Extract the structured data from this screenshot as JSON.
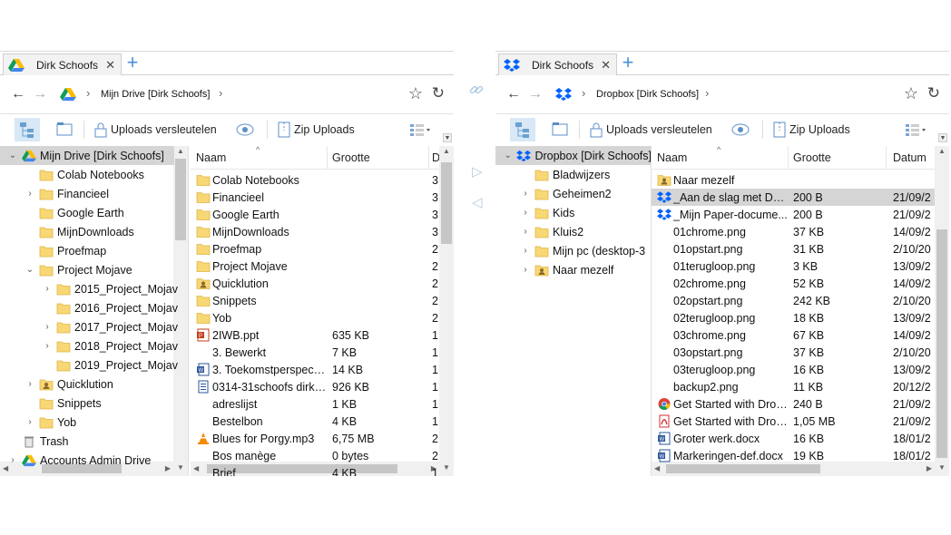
{
  "colors": {
    "accent": "#4a90d9",
    "folder": "#f8d775",
    "folder_edge": "#e0b545",
    "selection": "#d5d5d5"
  },
  "left": {
    "tab": {
      "title": "Dirk Schoofs",
      "close": "✕",
      "icon": "google-drive-icon"
    },
    "new_tab": "+",
    "nav": {
      "back": "←",
      "forward": "→",
      "sep": "›",
      "crumb": "Mijn Drive [Dirk Schoofs]",
      "star": "☆",
      "refresh": "↻"
    },
    "toolbar": {
      "encrypt": "Uploads versleutelen",
      "zip": "Zip Uploads"
    },
    "tree": [
      {
        "label": "Mijn Drive [Dirk Schoofs]",
        "arrow": "⌄",
        "level": 0,
        "icon": "drive",
        "selected": true
      },
      {
        "label": "Colab Notebooks",
        "arrow": "",
        "level": 1,
        "icon": "folder"
      },
      {
        "label": "Financieel",
        "arrow": "›",
        "level": 1,
        "icon": "folder"
      },
      {
        "label": "Google Earth",
        "arrow": "",
        "level": 1,
        "icon": "folder"
      },
      {
        "label": "MijnDownloads",
        "arrow": "",
        "level": 1,
        "icon": "folder"
      },
      {
        "label": "Proefmap",
        "arrow": "",
        "level": 1,
        "icon": "folder"
      },
      {
        "label": "Project Mojave",
        "arrow": "⌄",
        "level": 1,
        "icon": "folder"
      },
      {
        "label": "2015_Project_Mojav",
        "arrow": "›",
        "level": 2,
        "icon": "folder"
      },
      {
        "label": "2016_Project_Mojav",
        "arrow": "",
        "level": 2,
        "icon": "folder"
      },
      {
        "label": "2017_Project_Mojav",
        "arrow": "›",
        "level": 2,
        "icon": "folder"
      },
      {
        "label": "2018_Project_Mojav",
        "arrow": "›",
        "level": 2,
        "icon": "folder"
      },
      {
        "label": "2019_Project_Mojav",
        "arrow": "",
        "level": 2,
        "icon": "folder"
      },
      {
        "label": "Quicklution",
        "arrow": "›",
        "level": 1,
        "icon": "shared"
      },
      {
        "label": "Snippets",
        "arrow": "",
        "level": 1,
        "icon": "folder"
      },
      {
        "label": "Yob",
        "arrow": "›",
        "level": 1,
        "icon": "folder"
      },
      {
        "label": "Trash",
        "arrow": "",
        "level": 0,
        "icon": "trash"
      },
      {
        "label": "Accounts Admin Drive",
        "arrow": "›",
        "level": 0,
        "icon": "drive"
      }
    ],
    "columns": {
      "name": "Naam",
      "size": "Grootte",
      "date": "D"
    },
    "files": [
      {
        "name": "Colab Notebooks",
        "size": "",
        "date": "3",
        "icon": "folder"
      },
      {
        "name": "Financieel",
        "size": "",
        "date": "3",
        "icon": "folder"
      },
      {
        "name": "Google Earth",
        "size": "",
        "date": "3",
        "icon": "folder"
      },
      {
        "name": "MijnDownloads",
        "size": "",
        "date": "3",
        "icon": "folder"
      },
      {
        "name": "Proefmap",
        "size": "",
        "date": "2",
        "icon": "folder"
      },
      {
        "name": "Project Mojave",
        "size": "",
        "date": "2",
        "icon": "folder"
      },
      {
        "name": "Quicklution",
        "size": "",
        "date": "2",
        "icon": "shared"
      },
      {
        "name": "Snippets",
        "size": "",
        "date": "2",
        "icon": "folder"
      },
      {
        "name": "Yob",
        "size": "",
        "date": "2",
        "icon": "folder"
      },
      {
        "name": "2IWB.ppt",
        "size": "635 KB",
        "date": "1",
        "icon": "ppt"
      },
      {
        "name": "3. Bewerkt",
        "size": "7 KB",
        "date": "1",
        "icon": "blank"
      },
      {
        "name": "3. Toekomstperspecti...",
        "size": "14 KB",
        "date": "1",
        "icon": "word"
      },
      {
        "name": "0314-31schoofs dirk.j...",
        "size": "926 KB",
        "date": "1",
        "icon": "doc"
      },
      {
        "name": "adreslijst",
        "size": "1 KB",
        "date": "1",
        "icon": "blank"
      },
      {
        "name": "Bestelbon",
        "size": "4 KB",
        "date": "1",
        "icon": "blank"
      },
      {
        "name": "Blues for Porgy.mp3",
        "size": "6,75 MB",
        "date": "2",
        "icon": "vlc"
      },
      {
        "name": "Bos manège",
        "size": "0 bytes",
        "date": "2",
        "icon": "blank"
      },
      {
        "name": "Brief",
        "size": "4 KB",
        "date": "1",
        "icon": "blank"
      }
    ]
  },
  "right": {
    "tab": {
      "title": "Dirk Schoofs",
      "close": "✕",
      "icon": "dropbox-icon"
    },
    "new_tab": "+",
    "nav": {
      "back": "←",
      "forward": "→",
      "sep": "›",
      "crumb": "Dropbox [Dirk Schoofs]",
      "star": "☆",
      "refresh": "↻"
    },
    "toolbar": {
      "encrypt": "Uploads versleutelen",
      "zip": "Zip Uploads"
    },
    "tree": [
      {
        "label": "Dropbox [Dirk Schoofs]",
        "arrow": "⌄",
        "level": 0,
        "icon": "dropbox",
        "selected": true
      },
      {
        "label": "Bladwijzers",
        "arrow": "",
        "level": 1,
        "icon": "folder"
      },
      {
        "label": "Geheimen2",
        "arrow": "›",
        "level": 1,
        "icon": "folder"
      },
      {
        "label": "Kids",
        "arrow": "›",
        "level": 1,
        "icon": "folder"
      },
      {
        "label": "Kluis2",
        "arrow": "›",
        "level": 1,
        "icon": "folder"
      },
      {
        "label": "Mijn pc (desktop-3",
        "arrow": "›",
        "level": 1,
        "icon": "folder"
      },
      {
        "label": "Naar mezelf",
        "arrow": "›",
        "level": 1,
        "icon": "shared"
      }
    ],
    "columns": {
      "name": "Naam",
      "size": "Grootte",
      "date": "Datum"
    },
    "files": [
      {
        "name": "Naar mezelf",
        "size": "",
        "date": "",
        "icon": "shared"
      },
      {
        "name": "_Aan de slag met Dro...",
        "size": "200 B",
        "date": "21/09/2",
        "icon": "dropbox",
        "selected": true
      },
      {
        "name": "_Mijn Paper-docume...",
        "size": "200 B",
        "date": "21/09/2",
        "icon": "dropbox"
      },
      {
        "name": "01chrome.png",
        "size": "37 KB",
        "date": "14/09/2",
        "icon": "blank"
      },
      {
        "name": "01opstart.png",
        "size": "31 KB",
        "date": "2/10/20",
        "icon": "blank"
      },
      {
        "name": "01terugloop.png",
        "size": "3 KB",
        "date": "13/09/2",
        "icon": "blank"
      },
      {
        "name": "02chrome.png",
        "size": "52 KB",
        "date": "14/09/2",
        "icon": "blank"
      },
      {
        "name": "02opstart.png",
        "size": "242 KB",
        "date": "2/10/20",
        "icon": "blank"
      },
      {
        "name": "02terugloop.png",
        "size": "18 KB",
        "date": "13/09/2",
        "icon": "blank"
      },
      {
        "name": "03chrome.png",
        "size": "67 KB",
        "date": "14/09/2",
        "icon": "blank"
      },
      {
        "name": "03opstart.png",
        "size": "37 KB",
        "date": "2/10/20",
        "icon": "blank"
      },
      {
        "name": "03terugloop.png",
        "size": "16 KB",
        "date": "13/09/2",
        "icon": "blank"
      },
      {
        "name": "backup2.png",
        "size": "11 KB",
        "date": "20/12/2",
        "icon": "blank"
      },
      {
        "name": "Get Started with Drop...",
        "size": "240 B",
        "date": "21/09/2",
        "icon": "chrome"
      },
      {
        "name": "Get Started with Drop...",
        "size": "1,05 MB",
        "date": "21/09/2",
        "icon": "pdf"
      },
      {
        "name": "Groter werk.docx",
        "size": "16 KB",
        "date": "18/01/2",
        "icon": "word"
      },
      {
        "name": "Markeringen-def.docx",
        "size": "19 KB",
        "date": "18/01/2",
        "icon": "word"
      }
    ]
  }
}
